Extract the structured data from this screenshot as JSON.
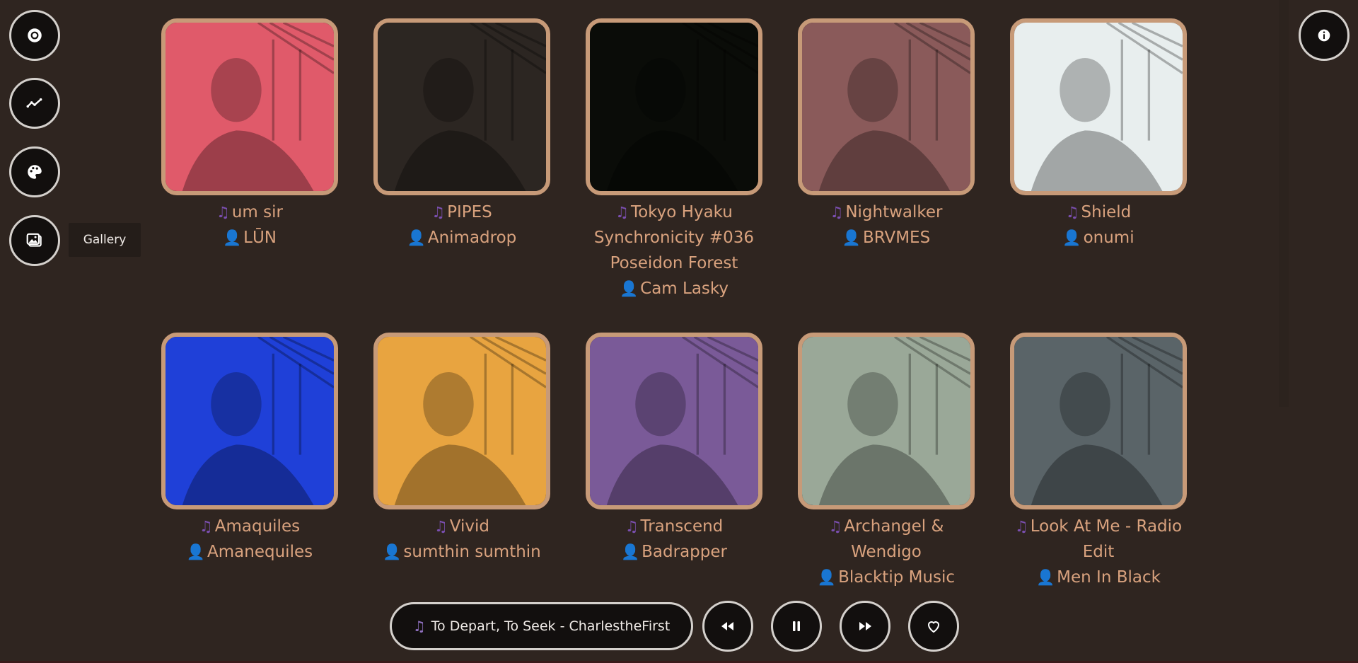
{
  "nav": {
    "items": [
      {
        "name": "music",
        "icon": "disc-icon"
      },
      {
        "name": "trends",
        "icon": "trend-line-icon"
      },
      {
        "name": "themes",
        "icon": "palette-icon"
      },
      {
        "name": "gallery",
        "icon": "image-gallery-icon"
      }
    ],
    "tooltip": "Gallery"
  },
  "info": {
    "icon": "info-icon"
  },
  "gallery": {
    "items": [
      {
        "title_lines": [
          "um sir"
        ],
        "artist": "LŪN",
        "tone": "#e05a6a"
      },
      {
        "title_lines": [
          "PIPES"
        ],
        "artist": "Animadrop",
        "tone": "#2c2622"
      },
      {
        "title_lines": [
          "Tokyo Hyaku",
          "Synchronicity #036",
          "Poseidon Forest"
        ],
        "artist": "Cam Lasky",
        "tone": "#0a0c08"
      },
      {
        "title_lines": [
          "Nightwalker"
        ],
        "artist": "BRVMES",
        "tone": "#8a5a5a"
      },
      {
        "title_lines": [
          "Shield"
        ],
        "artist": "onumi",
        "tone": "#e8eeee"
      },
      {
        "title_lines": [
          "Amaquiles"
        ],
        "artist": "Amanequiles",
        "tone": "#1f40d8"
      },
      {
        "title_lines": [
          "Vivid"
        ],
        "artist": "sumthin sumthin",
        "tone": "#e8a440"
      },
      {
        "title_lines": [
          "Transcend"
        ],
        "artist": "Badrapper",
        "tone": "#7a5a98"
      },
      {
        "title_lines": [
          "Archangel &",
          "Wendigo"
        ],
        "artist": "Blacktip Music",
        "tone": "#9aa898"
      },
      {
        "title_lines": [
          "Look At Me - Radio",
          "Edit"
        ],
        "artist": "Men In Black",
        "tone": "#5a6468"
      }
    ]
  },
  "player": {
    "now_playing": "To Depart, To Seek - CharlestheFirst",
    "controls": [
      {
        "name": "rewind-button",
        "icon": "rewind-icon"
      },
      {
        "name": "pause-button",
        "icon": "pause-icon"
      },
      {
        "name": "fast-forward-button",
        "icon": "fast-forward-icon"
      },
      {
        "name": "favorite-button",
        "icon": "heart-icon"
      }
    ]
  }
}
